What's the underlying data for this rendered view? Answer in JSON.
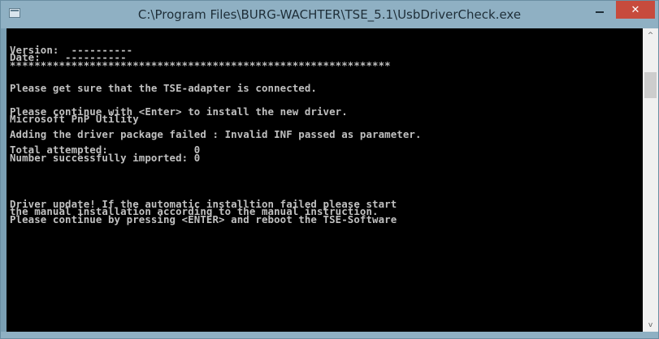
{
  "window": {
    "title": "C:\\Program Files\\BURG-WACHTER\\TSE_5.1\\UsbDriverCheck.exe",
    "icon": "console-app-icon",
    "controls": {
      "minimize": "minimize-icon",
      "maximize": "maximize-icon",
      "close": "close-icon",
      "close_glyph": "✕"
    },
    "frame_color": "#8fb0c3",
    "close_color": "#c74b3d"
  },
  "console": {
    "background": "#000000",
    "foreground": "#c0c0c0",
    "lines": [
      "",
      "Version:  ----------",
      "Date:    ----------",
      "**************************************************************",
      "",
      "",
      "Please get sure that the TSE-adapter is connected.",
      "",
      "",
      "Please continue with <Enter> to install the new driver.",
      "Microsoft PnP Utility",
      "",
      "Adding the driver package failed : Invalid INF passed as parameter.",
      "",
      "Total attempted:              0",
      "Number successfully imported: 0",
      "",
      "",
      "",
      "",
      "",
      "Driver update! If the automatic installtion failed please start",
      "the manual installation according to the manual instruction.",
      "Please continue by pressing <ENTER> and reboot the TSE-Software"
    ]
  },
  "scrollbar": {
    "up_glyph": "^",
    "down_glyph": "v"
  }
}
